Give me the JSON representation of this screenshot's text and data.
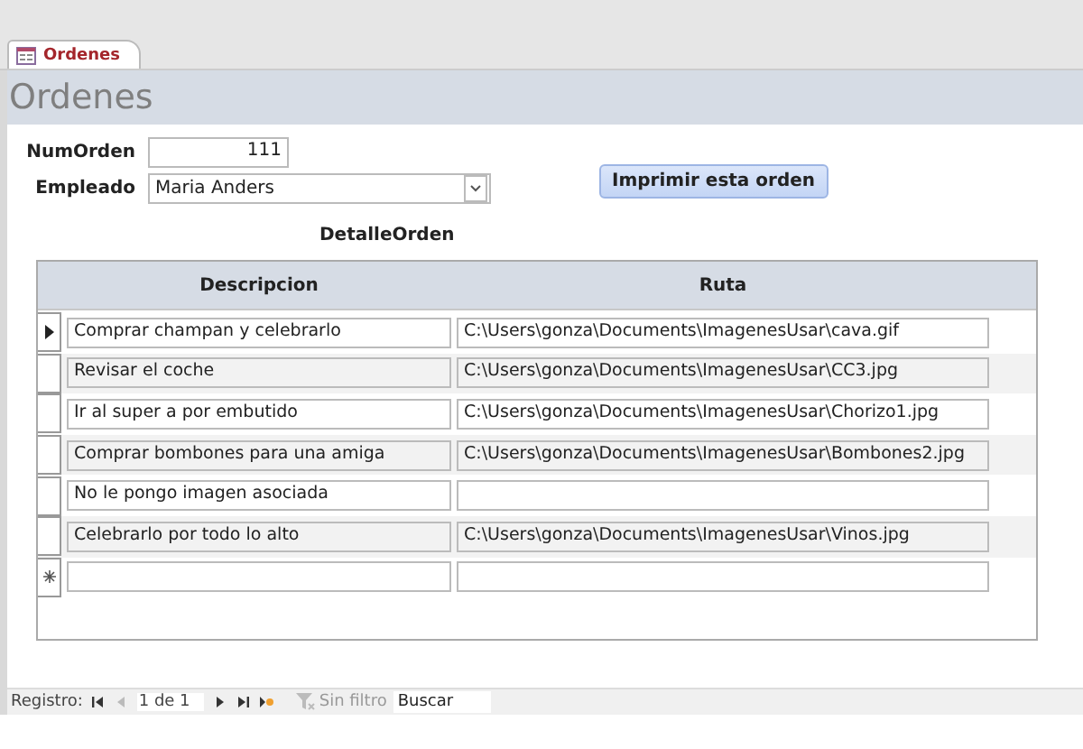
{
  "tab": {
    "label": "Ordenes",
    "selected": true
  },
  "form_title": "Ordenes",
  "fields": {
    "num_orden": {
      "label": "NumOrden",
      "value": "111"
    },
    "empleado": {
      "label": "Empleado",
      "value": "Maria Anders"
    }
  },
  "print_button": "Imprimir esta orden",
  "subform": {
    "title": "DetalleOrden",
    "columns": [
      "Descripcion",
      "Ruta"
    ],
    "rows": [
      {
        "selected": true,
        "descripcion": "Comprar champan y celebrarlo",
        "ruta": "C:\\Users\\gonza\\Documents\\ImagenesUsar\\cava.gif"
      },
      {
        "selected": false,
        "descripcion": "Revisar el coche",
        "ruta": "C:\\Users\\gonza\\Documents\\ImagenesUsar\\CC3.jpg"
      },
      {
        "selected": false,
        "descripcion": "Ir al super a por embutido",
        "ruta": "C:\\Users\\gonza\\Documents\\ImagenesUsar\\Chorizo1.jpg"
      },
      {
        "selected": false,
        "descripcion": "Comprar bombones para una amiga",
        "ruta": "C:\\Users\\gonza\\Documents\\ImagenesUsar\\Bombones2.jpg"
      },
      {
        "selected": false,
        "descripcion": "No le pongo imagen asociada"
      },
      {
        "selected": false,
        "descripcion": "Celebrarlo por todo lo alto",
        "ruta": "C:\\Users\\gonza\\Documents\\ImagenesUsar\\Vinos.jpg"
      }
    ]
  },
  "navigation": {
    "label": "Registro:",
    "position": "1 de 1",
    "filter": {
      "label": "Sin filtro",
      "disabled": true
    },
    "search_placeholder": "Buscar"
  }
}
